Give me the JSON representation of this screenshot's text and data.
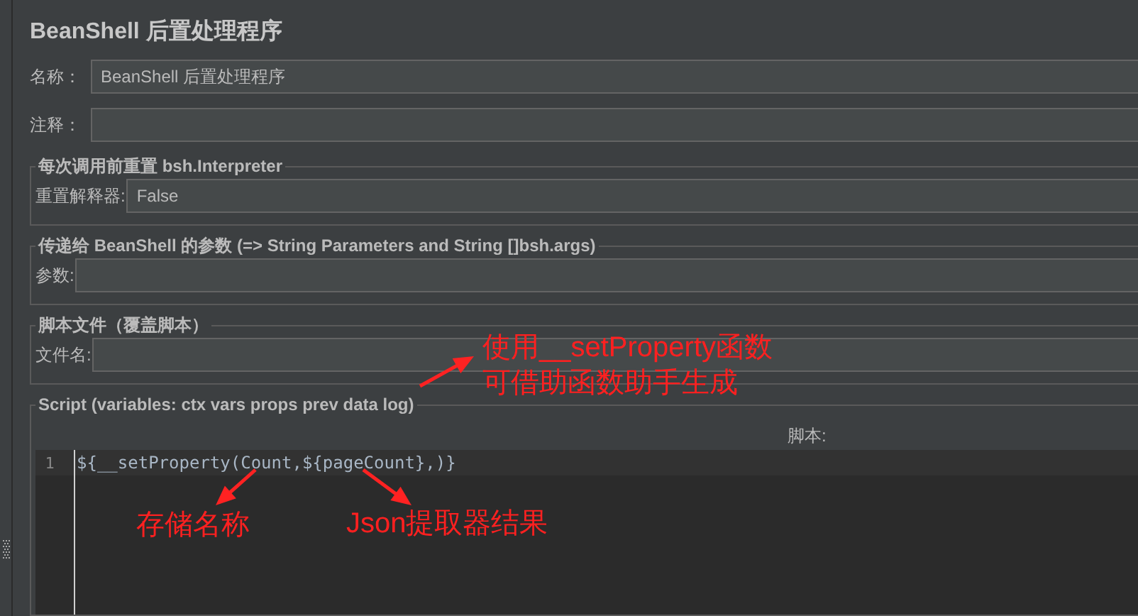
{
  "title": "BeanShell 后置处理程序",
  "fields": [
    {
      "label": "名称：",
      "value": "BeanShell 后置处理程序"
    },
    {
      "label": "注释："
    }
  ],
  "groups": [
    {
      "legend": "每次调用前重置 bsh.Interpreter",
      "label": "重置解释器:",
      "value": "False"
    },
    {
      "legend": "传递给 BeanShell 的参数 (=> String Parameters and String []bsh.args)",
      "label": "参数:"
    },
    {
      "legend": "脚本文件（覆盖脚本）",
      "label": "文件名:"
    }
  ],
  "script": {
    "legend": "Script (variables: ctx vars props prev data log)",
    "header": "脚本:",
    "lines": [
      {
        "number": "1",
        "text": "${__setProperty(Count,${pageCount},)}"
      }
    ]
  },
  "annotations": [
    {
      "lines": [
        "使用__setProperty函数",
        "可借助函数助手生成"
      ]
    },
    {
      "lines": [
        "存储名称"
      ]
    },
    {
      "lines": [
        "Json提取器结果"
      ]
    }
  ]
}
